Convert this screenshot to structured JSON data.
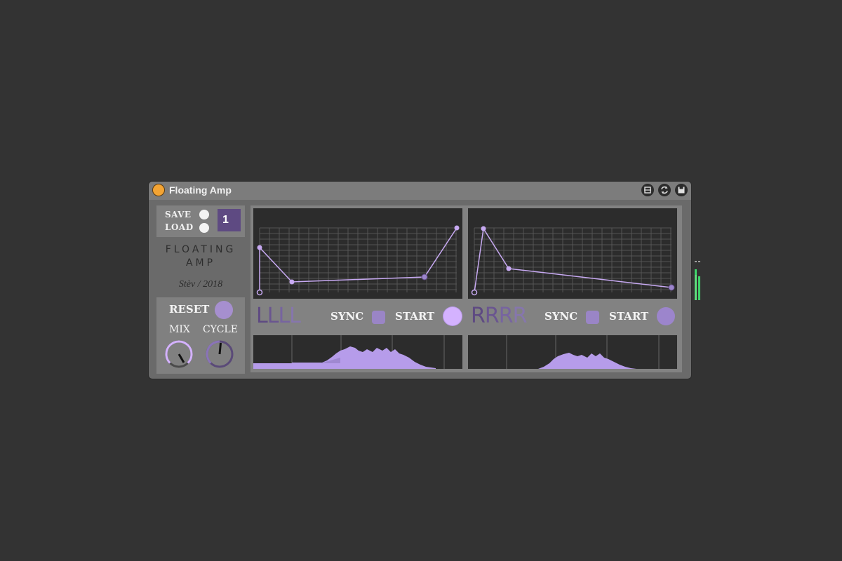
{
  "device": {
    "title": "Floating Amp",
    "colors": {
      "accent": "#a68fcf",
      "accent_light": "#d4b2ff",
      "dark_purple": "#5e4a82",
      "power": "#f3a434"
    },
    "title_icons": [
      "chooser-icon",
      "refresh-icon",
      "save-icon"
    ]
  },
  "preset": {
    "save_label": "SAVE",
    "load_label": "LOAD",
    "number": "1"
  },
  "branding": {
    "name_line1": "FLOATING",
    "name_line2": "AMP",
    "author": "Stèv / 2018"
  },
  "controls": {
    "reset_label": "RESET",
    "mix_label": "MIX",
    "cycle_label": "CYCLE"
  },
  "left_channel": {
    "letters": [
      "L",
      "L",
      "L",
      "L"
    ],
    "sync_label": "SYNC",
    "start_label": "START"
  },
  "right_channel": {
    "letters": [
      "R",
      "R",
      "R",
      "R"
    ],
    "sync_label": "SYNC",
    "start_label": "START"
  }
}
